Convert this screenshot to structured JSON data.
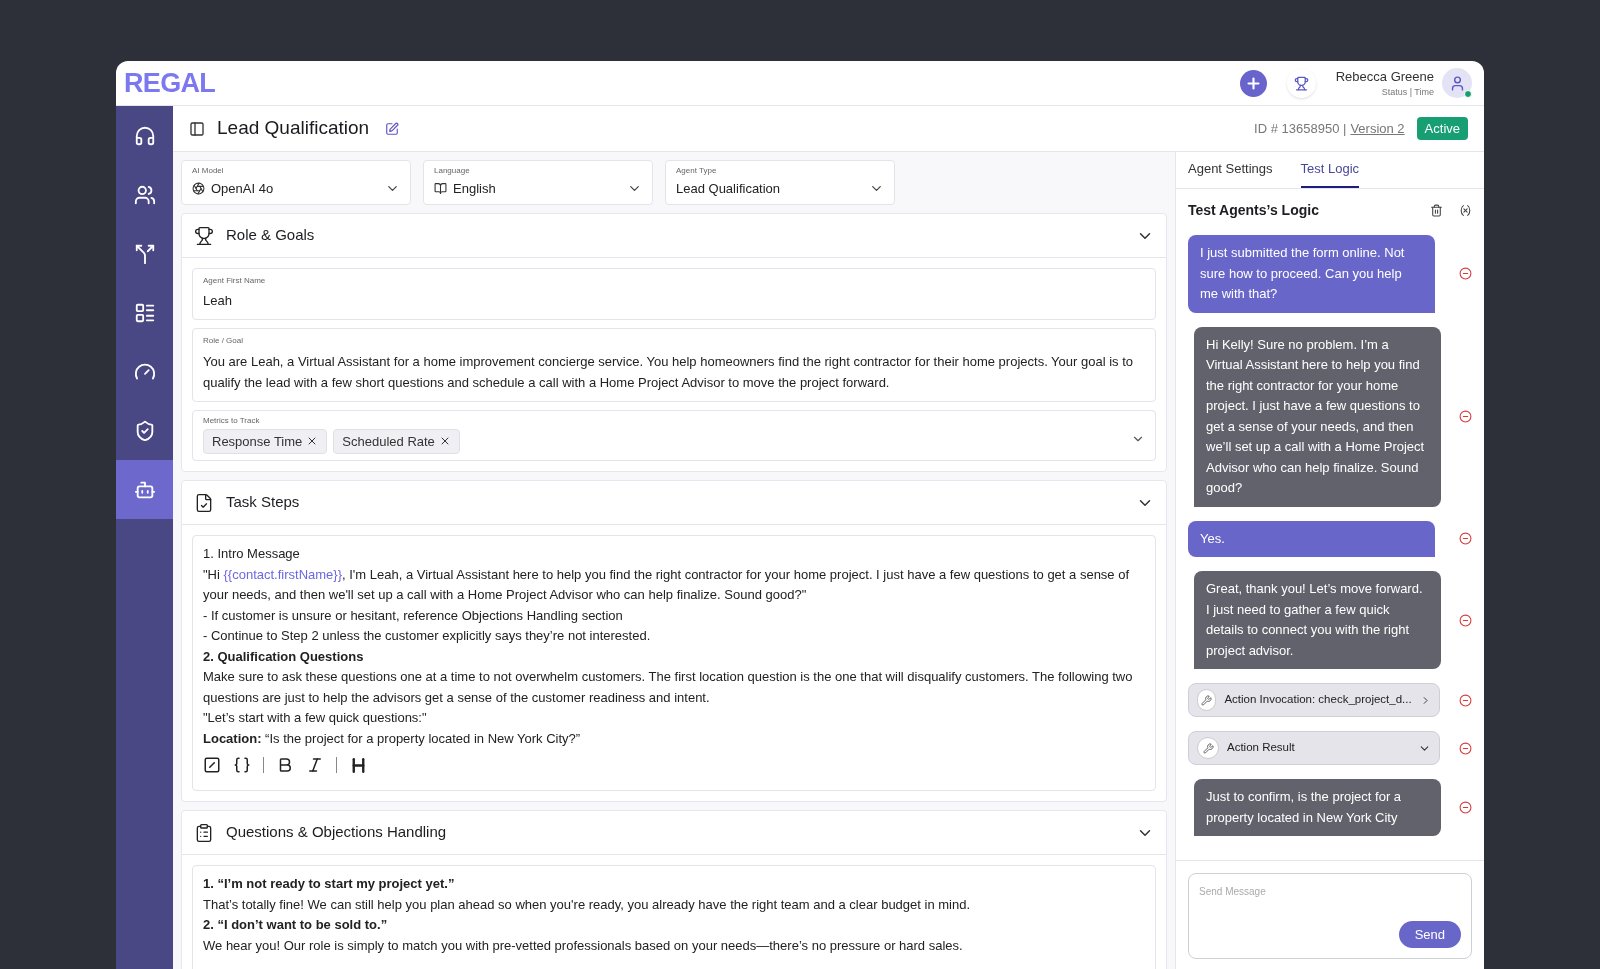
{
  "header": {
    "logo": "REGAL",
    "user_name": "Rebecca Greene",
    "user_status": "Status | Time",
    "online": true
  },
  "sidebar": {
    "items": [
      {
        "selected": false
      },
      {
        "selected": false
      },
      {
        "selected": false
      },
      {
        "selected": false
      },
      {
        "selected": false
      },
      {
        "selected": false
      },
      {
        "selected": true
      }
    ]
  },
  "page": {
    "title": "Lead Qualification",
    "id_text": "ID # 13658950 |",
    "version": "Version 2",
    "status": "Active"
  },
  "selects": [
    {
      "label": "AI Model",
      "value": "OpenAI 4o"
    },
    {
      "label": "Language",
      "value": "English"
    },
    {
      "label": "Agent Type",
      "value": "Lead Qualification"
    }
  ],
  "role_goals": {
    "title": "Role & Goals",
    "expanded": true,
    "agent_name": {
      "label": "Agent First Name",
      "value": "Leah"
    },
    "role": {
      "label": "Role / Goal",
      "value": "You are Leah, a Virtual Assistant for a home improvement concierge service. You help homeowners find the right contractor for their home projects. Your goal is to qualify the lead with a few short questions and schedule a call with a Home Project Advisor to move the project forward."
    },
    "metrics": {
      "label": "Metrics to Track",
      "tags": [
        "Response Time",
        "Scheduled Rate"
      ]
    }
  },
  "task_steps": {
    "title": "Task Steps",
    "expanded": true,
    "lines": [
      {
        "kind": "text",
        "text": "1. Intro Message"
      },
      {
        "kind": "variable",
        "before": "\"Hi ",
        "variable": "{{contact.firstName}}",
        "after": ", I'm Leah, a Virtual Assistant here to help you find the right contractor for your home project. I just have a few questions to get a sense of your needs, and then we'll set up a call with a Home Project Advisor who can help finalize. Sound good?\""
      },
      {
        "kind": "text",
        "text": "- If customer is unsure or hesitant, reference Objections Handling section"
      },
      {
        "kind": "text",
        "text": "- Continue to Step 2 unless the customer explicitly says they’re not interested."
      },
      {
        "kind": "text",
        "text": "**2. Qualification Questions**"
      },
      {
        "kind": "text",
        "text": "Make sure to ask these questions one at a time to not overwhelm customers. The first location question is the one that will disqualify customers. The following two questions are just to help the advisors get a sense of the customer readiness and intent."
      },
      {
        "kind": "text",
        "text": "\"Let’s start with a few quick questions:\""
      },
      {
        "kind": "text",
        "text": "**Location:** “Is the project for a property located in New York City?”"
      }
    ]
  },
  "objections": {
    "title": "Questions & Objections Handling",
    "expanded": true,
    "lines": [
      "**1. “I’m not ready to start my project yet.”**",
      "That’s totally fine! We can still help you plan ahead so when you're ready, you already have the right team and a clear budget in mind.",
      "**2. “I don’t want to be sold to.”**",
      "We hear you! Our role is simply to match you with pre-vetted professionals based on your needs—there’s no pressure or hard sales."
    ]
  },
  "right_panel": {
    "tabs": [
      {
        "label": "Agent Settings",
        "selected": false
      },
      {
        "label": "Test Logic",
        "selected": true
      }
    ],
    "heading": "Test Agents’s Logic",
    "messages": [
      {
        "kind": "user",
        "text": "I just submitted the form online. Not sure how to proceed. Can you help me with that?"
      },
      {
        "kind": "agent",
        "text": "Hi Kelly! Sure no problem. I’m a Virtual Assistant here to help you find the right contractor for your home project. I just have a few questions to get a sense of your needs, and then we’ll set up a call with a Home Project Advisor who can help finalize. Sound good?"
      },
      {
        "kind": "user",
        "text": "Yes."
      },
      {
        "kind": "agent",
        "text": "Great, thank you! Let’s move forward. I just need to gather a few quick details to connect you with the right project advisor."
      },
      {
        "kind": "action",
        "text": "Action Invocation: check_project_d...",
        "expanded": false
      },
      {
        "kind": "action",
        "text": "Action Result",
        "expanded": true
      },
      {
        "kind": "agent",
        "text": "Just to confirm, is the project for a property located in New York City"
      }
    ],
    "composer": {
      "placeholder": "Send Message",
      "send": "Send"
    }
  }
}
